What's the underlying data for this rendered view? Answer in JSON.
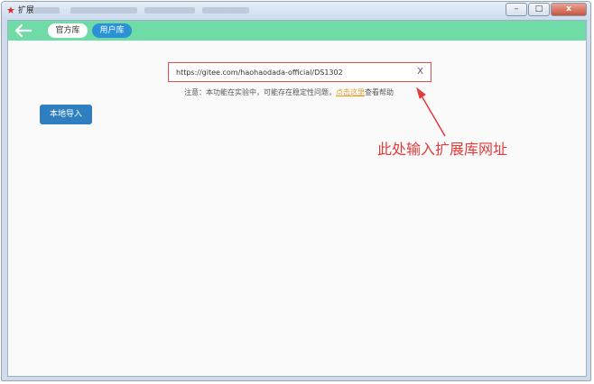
{
  "window": {
    "title": "扩展",
    "minimize_glyph": "–",
    "maximize_glyph": "□",
    "close_glyph": "x"
  },
  "toolbar": {
    "back_icon": "back-arrow-icon",
    "tabs": [
      {
        "label": "官方库",
        "active": false
      },
      {
        "label": "用户库",
        "active": true
      }
    ],
    "bar_color": "#6fdba7",
    "active_tab_color": "#2c92d6"
  },
  "url_input": {
    "value": "https://gitee.com/haohaodada-official/DS1302",
    "clear_label": "X"
  },
  "notice": {
    "prefix": "注意：本功能在实验中，可能存在稳定性问题，",
    "link": "点击这里",
    "suffix": "查看帮助"
  },
  "import_button": {
    "label": "本地导入"
  },
  "annotation": {
    "text": "此处输入扩展库网址",
    "color": "#e23b3b"
  }
}
